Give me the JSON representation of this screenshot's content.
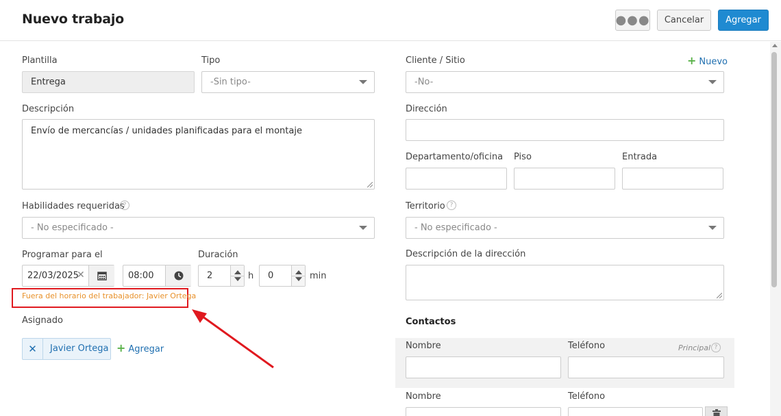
{
  "header": {
    "title": "Nuevo trabajo",
    "more_label": "●●●",
    "cancel_label": "Cancelar",
    "add_label": "Agregar"
  },
  "left": {
    "plantilla": {
      "label": "Plantilla",
      "value": "Entrega"
    },
    "tipo": {
      "label": "Tipo",
      "value": "-Sin tipo-"
    },
    "descripcion": {
      "label": "Descripción",
      "value": "Envío de mercancías / unidades planificadas para el montaje"
    },
    "habilidades": {
      "label": "Habilidades requeridas",
      "value": "- No especificado -"
    },
    "programar": {
      "label": "Programar para el",
      "date": "22/03/2025",
      "time": "08:00"
    },
    "duracion": {
      "label": "Duración",
      "hours": "2",
      "hours_unit": "h",
      "minutes": "0",
      "minutes_unit": "min"
    },
    "warning": "Fuera del horario del trabajador: Javier Ortega",
    "asignado": {
      "label": "Asignado",
      "chip_name": "Javier Ortega",
      "add_label": "Agregar"
    }
  },
  "right": {
    "cliente": {
      "label": "Cliente / Sitio",
      "value": "-No-",
      "new_label": "Nuevo"
    },
    "direccion": {
      "label": "Dirección",
      "value": ""
    },
    "departamento": {
      "label": "Departamento/oficina",
      "value": ""
    },
    "piso": {
      "label": "Piso",
      "value": ""
    },
    "entrada": {
      "label": "Entrada",
      "value": ""
    },
    "territorio": {
      "label": "Territorio",
      "value": "- No especificado -"
    },
    "desc_direccion": {
      "label": "Descripción de la dirección",
      "value": ""
    },
    "contactos": {
      "title": "Contactos",
      "principal_label": "Principal",
      "rows": [
        {
          "name_label": "Nombre",
          "phone_label": "Teléfono",
          "name": "",
          "phone": ""
        },
        {
          "name_label": "Nombre",
          "phone_label": "Teléfono",
          "name": "",
          "phone": ""
        }
      ]
    }
  },
  "colors": {
    "accent": "#1f8ad1",
    "warning_text": "#e8902a",
    "annotation_red": "#e0191f",
    "add_green": "#5ab24a"
  },
  "icons": [
    "calendar-icon",
    "clock-icon",
    "help-icon",
    "chevron-down-icon",
    "close-icon",
    "plus-icon",
    "trash-icon",
    "annotation-arrow"
  ]
}
